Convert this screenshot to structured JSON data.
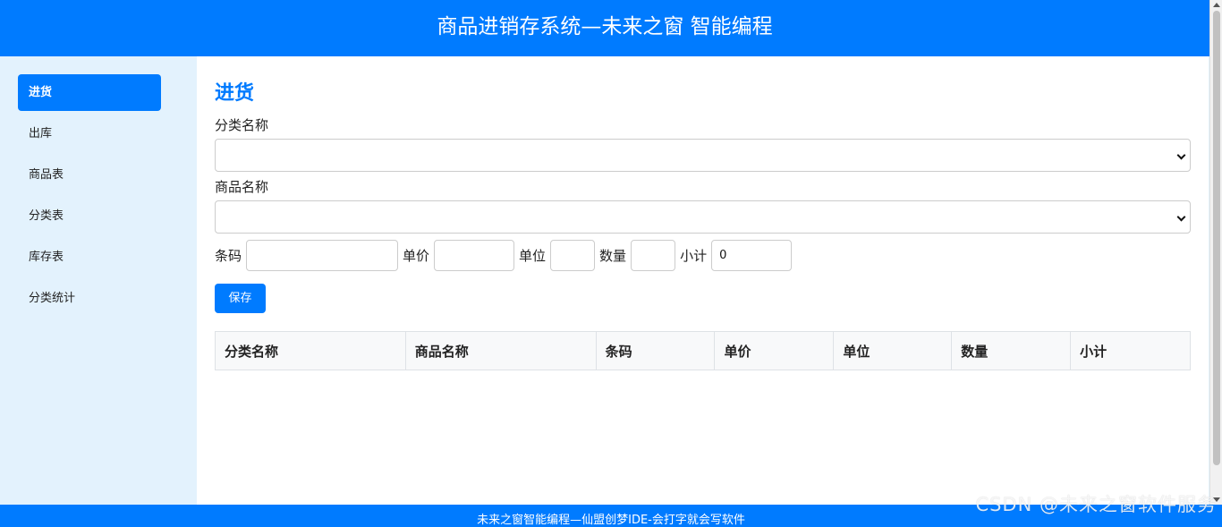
{
  "header": {
    "title": "商品进销存系统—未来之窗 智能编程"
  },
  "sidebar": {
    "items": [
      {
        "label": "进货",
        "active": true
      },
      {
        "label": "出库"
      },
      {
        "label": "商品表"
      },
      {
        "label": "分类表"
      },
      {
        "label": "库存表"
      },
      {
        "label": "分类统计"
      }
    ]
  },
  "main": {
    "title": "进货",
    "category_label": "分类名称",
    "category_value": "",
    "product_label": "商品名称",
    "product_value": "",
    "barcode_label": "条码",
    "barcode_value": "",
    "price_label": "单价",
    "price_value": "",
    "unit_label": "单位",
    "unit_value": "",
    "qty_label": "数量",
    "qty_value": "",
    "subtotal_label": "小计",
    "subtotal_value": "0",
    "save_label": "保存",
    "table_headers": [
      "分类名称",
      "商品名称",
      "条码",
      "单价",
      "单位",
      "数量",
      "小计"
    ]
  },
  "footer": {
    "text": "未来之窗智能编程—仙盟创梦IDE-会打字就会写软件"
  },
  "watermark": {
    "text": "CSDN @未来之窗软件服务"
  },
  "colors": {
    "accent": "#007bff",
    "sidebar_bg": "#e3f2fd"
  }
}
